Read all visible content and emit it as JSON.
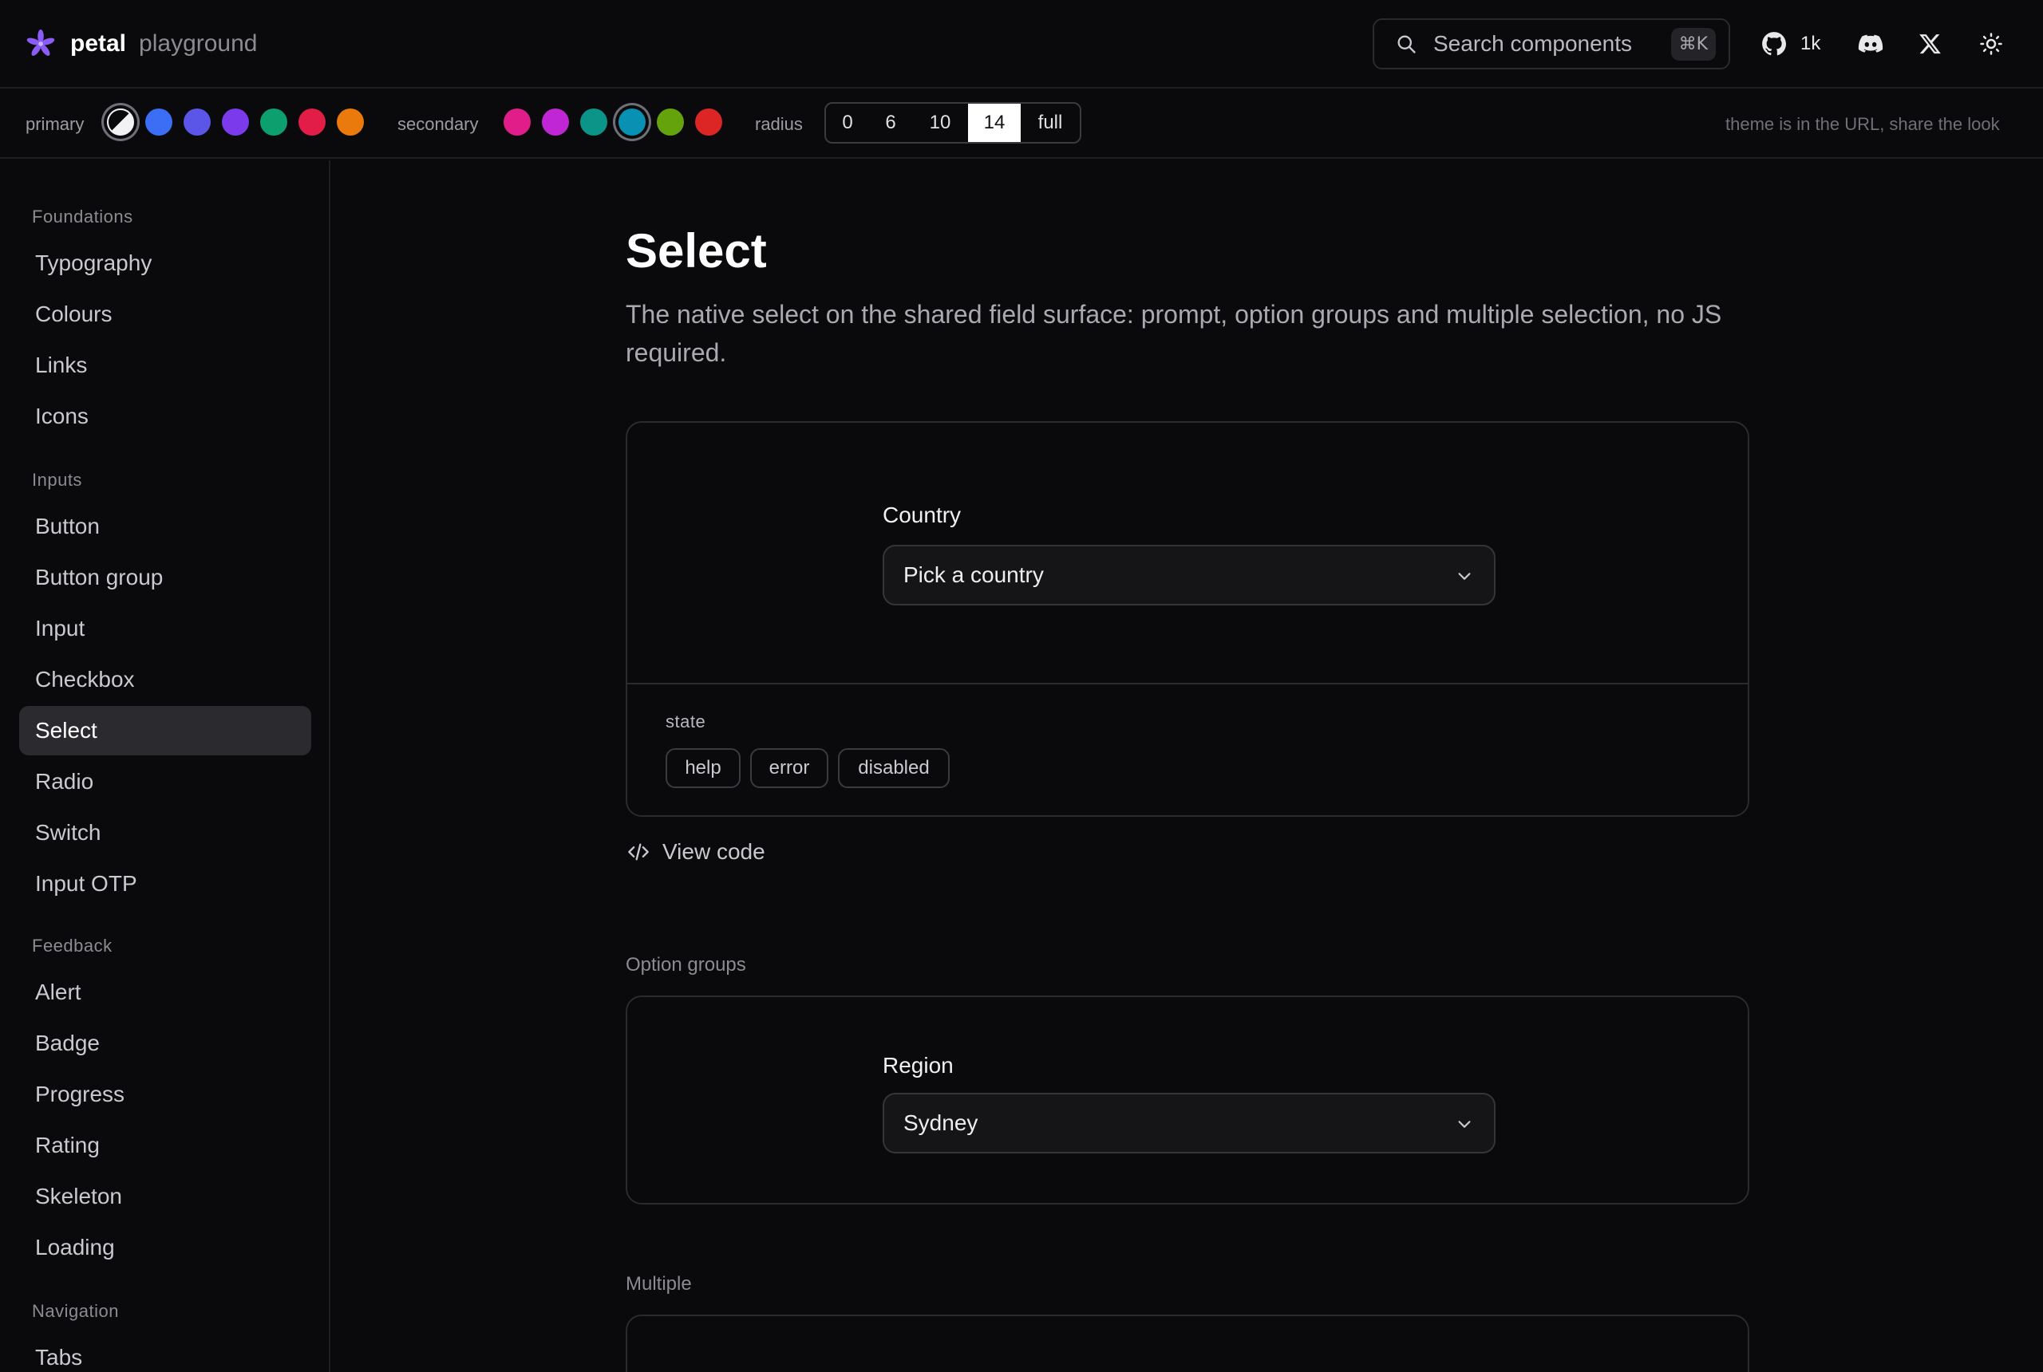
{
  "header": {
    "brand_name": "petal",
    "brand_sub": "playground",
    "search_placeholder": "Search components",
    "search_shortcut": "⌘K",
    "github_count": "1k"
  },
  "themebar": {
    "primary_label": "primary",
    "secondary_label": "secondary",
    "radius_label": "radius",
    "radius_options": [
      "0",
      "6",
      "10",
      "14",
      "full"
    ],
    "radius_selected": "14",
    "note": "theme is in the URL, share the look",
    "primary_colors": [
      "#ffffff",
      "#3b6ef5",
      "#5b55e8",
      "#7c3aed",
      "#0e9f6e",
      "#e11d48",
      "#ea7a0c"
    ],
    "secondary_colors": [
      "#e11d8a",
      "#c026d3",
      "#0d9488",
      "#0891b2",
      "#65a30d",
      "#dc2626"
    ],
    "primary_selected": "#ffffff",
    "secondary_selected": "#0891b2"
  },
  "sidebar": {
    "groups": [
      {
        "label": "Foundations",
        "items": [
          "Typography",
          "Colours",
          "Links",
          "Icons"
        ]
      },
      {
        "label": "Inputs",
        "items": [
          "Button",
          "Button group",
          "Input",
          "Checkbox",
          "Select",
          "Radio",
          "Switch",
          "Input OTP"
        ]
      },
      {
        "label": "Feedback",
        "items": [
          "Alert",
          "Badge",
          "Progress",
          "Rating",
          "Skeleton",
          "Loading"
        ]
      },
      {
        "label": "Navigation",
        "items": [
          "Tabs"
        ]
      }
    ],
    "active": "Select"
  },
  "main": {
    "title": "Select",
    "description": "The native select on the shared field surface: prompt, option groups and multiple selection, no JS required.",
    "demo1": {
      "label": "Country",
      "value": "Pick a country",
      "state_label": "state",
      "state_chips": [
        "help",
        "error",
        "disabled"
      ]
    },
    "view_code": "View code",
    "section2_label": "Option groups",
    "demo2": {
      "label": "Region",
      "value": "Sydney"
    },
    "section3_label": "Multiple"
  }
}
